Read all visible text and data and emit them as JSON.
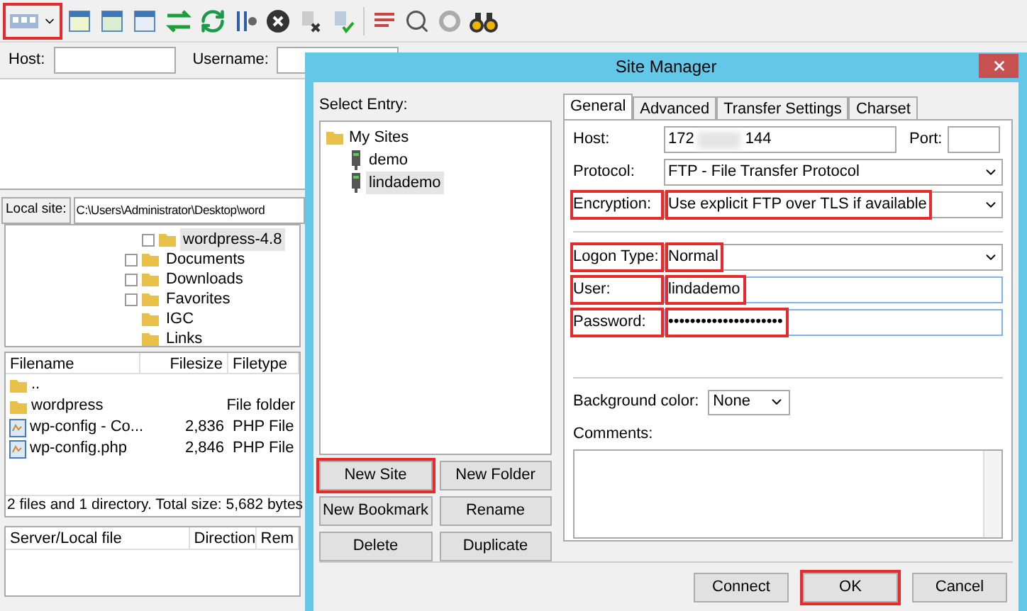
{
  "toolbar": {
    "site_manager_highlighted": true
  },
  "quickconnect": {
    "host_label": "Host:",
    "username_label": "Username:"
  },
  "local_site": {
    "label": "Local site:",
    "path": "C:\\Users\\Administrator\\Desktop\\word"
  },
  "local_tree": {
    "nested": [
      {
        "label": "wordpress-4.8",
        "expandable": true,
        "selected": true
      }
    ],
    "items": [
      {
        "label": "Documents",
        "expandable": true,
        "selected": false
      },
      {
        "label": "Downloads",
        "expandable": true,
        "selected": false
      },
      {
        "label": "Favorites",
        "expandable": true,
        "selected": false
      },
      {
        "label": "IGC",
        "expandable": false,
        "selected": false
      },
      {
        "label": "Links",
        "expandable": false,
        "selected": false
      }
    ]
  },
  "file_list": {
    "columns": [
      "Filename",
      "Filesize",
      "Filetype"
    ],
    "rows": [
      {
        "kind": "folder",
        "name": "..",
        "size": "",
        "type": ""
      },
      {
        "kind": "folder",
        "name": "wordpress",
        "size": "",
        "type": "File folder"
      },
      {
        "kind": "file",
        "name": "wp-config - Co...",
        "size": "2,836",
        "type": "PHP File"
      },
      {
        "kind": "file",
        "name": "wp-config.php",
        "size": "2,846",
        "type": "PHP File"
      }
    ],
    "status": "2 files and 1 directory. Total size: 5,682 bytes"
  },
  "queue": {
    "columns": [
      "Server/Local file",
      "Direction",
      "Rem"
    ]
  },
  "dialog": {
    "title": "Site Manager",
    "select_label": "Select Entry:",
    "sites": {
      "label": "My Sites",
      "children": [
        {
          "label": "demo",
          "selected": false
        },
        {
          "label": "lindademo",
          "selected": true
        }
      ]
    },
    "left_buttons": [
      {
        "label": "New Site",
        "highlighted": true
      },
      {
        "label": "New Folder",
        "highlighted": false
      },
      {
        "label": "New Bookmark",
        "highlighted": false
      },
      {
        "label": "Rename",
        "highlighted": false
      },
      {
        "label": "Delete",
        "highlighted": false
      },
      {
        "label": "Duplicate",
        "highlighted": false
      }
    ],
    "tabs": [
      {
        "label": "General",
        "selected": true
      },
      {
        "label": "Advanced",
        "selected": false
      },
      {
        "label": "Transfer Settings",
        "selected": false
      },
      {
        "label": "Charset",
        "selected": false
      }
    ],
    "host": {
      "label": "Host:",
      "value_parts": [
        "172",
        "144"
      ],
      "port_label": "Port:"
    },
    "connection_fields": [
      {
        "kind": "select",
        "label": "Protocol:",
        "value": "FTP - File Transfer Protocol",
        "highlighted": false
      },
      {
        "kind": "select",
        "label": "Encryption:",
        "value": "Use explicit FTP over TLS if available",
        "highlighted": true
      }
    ],
    "login_fields": [
      {
        "kind": "select",
        "label": "Logon Type:",
        "value": "Normal",
        "highlighted": true
      },
      {
        "kind": "text",
        "label": "User:",
        "value": "lindademo",
        "highlighted": true
      },
      {
        "kind": "password",
        "label": "Password:",
        "value": "•••••••••••••••••••••",
        "highlighted": true
      }
    ],
    "background": {
      "label": "Background color:",
      "value": "None"
    },
    "comments_label": "Comments:",
    "buttons": [
      {
        "label": "Connect",
        "highlighted": false
      },
      {
        "label": "OK",
        "highlighted": true
      },
      {
        "label": "Cancel",
        "highlighted": false
      }
    ]
  }
}
